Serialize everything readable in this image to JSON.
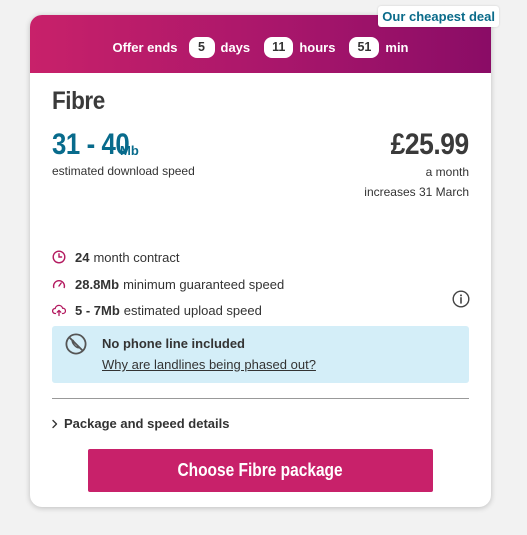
{
  "badge": {
    "label": "Our cheapest deal"
  },
  "offer": {
    "prefix": "Offer ends",
    "days_value": "5",
    "days_label": "days",
    "hours_value": "11",
    "hours_label": "hours",
    "minutes_value": "51",
    "minutes_label": "min"
  },
  "plan": {
    "name": "Fibre",
    "speed_range": "31 - 40",
    "speed_unit": "Mb",
    "speed_caption": "estimated download speed",
    "price": "£25.99",
    "price_period": "a month",
    "price_note": "increases 31 March"
  },
  "features": [
    {
      "icon": "clock-icon",
      "bold": "24",
      "text": "month contract"
    },
    {
      "icon": "speedometer-icon",
      "bold": "28.8Mb",
      "text": "minimum guaranteed speed"
    },
    {
      "icon": "cloud-upload-icon",
      "bold": "5 - 7Mb",
      "text": "estimated upload speed"
    }
  ],
  "phone": {
    "title": "No phone line included",
    "link": "Why are landlines being phased out?"
  },
  "details_label": "Package and speed details",
  "cta_label": "Choose Fibre package",
  "colors": {
    "brand": "#c8216a",
    "brand_dark": "#8a0c66",
    "speed_text": "#086b8c",
    "info_bg": "#d4eef8"
  }
}
